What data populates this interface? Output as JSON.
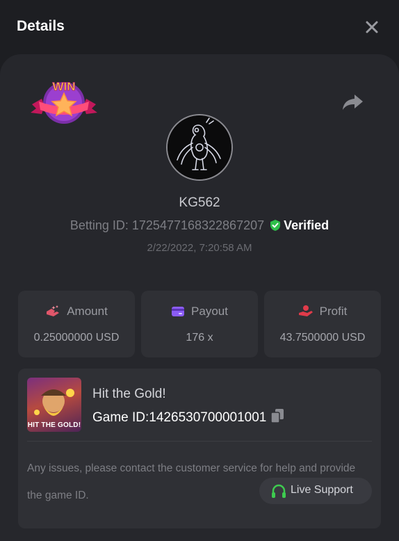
{
  "header": {
    "title": "Details"
  },
  "badge": {
    "text": "WIN"
  },
  "user": {
    "name": "KG562",
    "betting_id_label": "Betting ID: 1725477168322867207",
    "verified_label": "Verified",
    "datetime": "2/22/2022, 7:20:58 AM"
  },
  "stats": [
    {
      "label": "Amount",
      "value": "0.25000000 USD",
      "icon": "amount-icon"
    },
    {
      "label": "Payout",
      "value": "176 x",
      "icon": "payout-card-icon"
    },
    {
      "label": "Profit",
      "value": "43.7500000 USD",
      "icon": "profit-hand-icon"
    }
  ],
  "game": {
    "thumbnail_text": "HIT THE GOLD!",
    "name": "Hit the Gold!",
    "game_id_label": "Game ID:1426530700001001"
  },
  "support": {
    "notice": "Any issues, please contact the customer service for help and provide the game ID.",
    "button_label": "Live Support"
  },
  "colors": {
    "background": "#1d1e22",
    "panel": "#26272c",
    "card": "#2f3035",
    "verified_green": "#2fbf4a",
    "payout_purple": "#8b5cf6",
    "profit_red": "#e03b4a",
    "support_green": "#3ecb4f"
  }
}
